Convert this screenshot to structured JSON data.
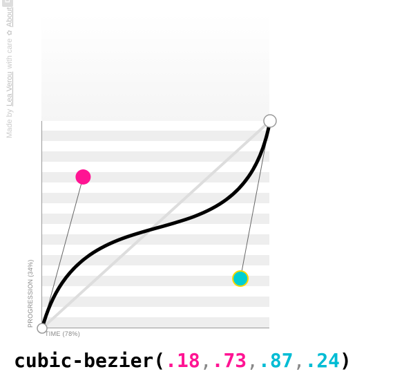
{
  "credit": {
    "prefix": "Made by",
    "author": "Lea Verou",
    "suffix": "with care",
    "about": "About",
    "donate": "DONATE"
  },
  "chart": {
    "axis_y": "PROGRESSION (34%)",
    "axis_x": "TIME (78%)"
  },
  "bezier": {
    "fn": "cubic-bezier",
    "p1x": ".18",
    "p1y": ".73",
    "p2x": ".87",
    "p2y": ".24"
  },
  "chart_data": {
    "type": "bezier-curve",
    "points": {
      "p0": [
        0,
        0
      ],
      "p1": [
        0.18,
        0.73
      ],
      "p2": [
        0.87,
        0.24
      ],
      "p3": [
        1,
        1
      ]
    },
    "xlabel": "TIME",
    "ylabel": "PROGRESSION",
    "xlim": [
      0,
      1
    ],
    "ylim": [
      0,
      1
    ],
    "cursor": {
      "time_pct": 78,
      "progression_pct": 34
    }
  }
}
